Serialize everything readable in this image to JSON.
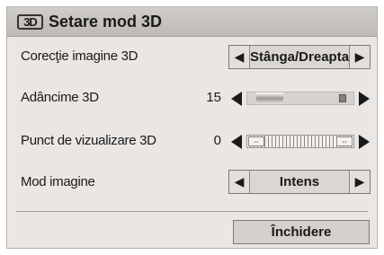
{
  "dialog": {
    "title_icon": "3D",
    "title": "Setare mod 3D"
  },
  "rows": {
    "correction": {
      "label": "Corecţie imagine 3D",
      "value": "Stânga/Dreapta"
    },
    "depth": {
      "label": "Adâncime 3D",
      "value": "15",
      "level_fraction": 0.15
    },
    "viewpoint": {
      "label": "Punct de vizualizare 3D",
      "value": "0"
    },
    "image_mode": {
      "label": "Mod imagine",
      "value": "Intens"
    }
  },
  "close_label": "Închidere",
  "icons": [
    "3d-icon",
    "arrow-left-icon",
    "arrow-right-icon"
  ],
  "colors": {
    "background": "#e9e6e4",
    "titlebar": "#c6c2bf",
    "text": "#1a1a1a"
  }
}
